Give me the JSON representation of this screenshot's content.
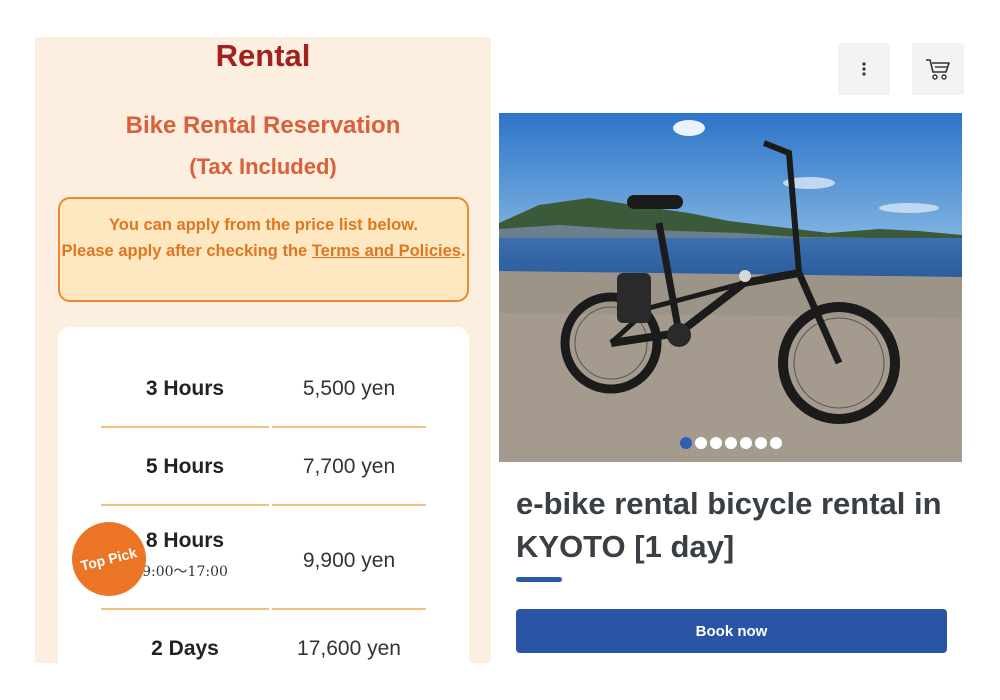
{
  "left": {
    "title": "Rental",
    "subtitle": "Bike Rental Reservation",
    "tax_note": "(Tax Included)",
    "notice": {
      "line1": "You can apply from the price list below.",
      "line2_prefix": "Please apply after checking the ",
      "link": "Terms and Policies",
      "suffix": "."
    },
    "prices": [
      {
        "name": "3 Hours",
        "price": "5,500 yen"
      },
      {
        "name": "5 Hours",
        "price": "7,700 yen"
      },
      {
        "name": "8 Hours",
        "sub": "9:00〜17:00",
        "price": "9,900 yen",
        "badge": "Top Pick"
      },
      {
        "name": "2 Days",
        "price": "17,600 yen"
      }
    ]
  },
  "right": {
    "menu_icon": "vertical-ellipsis-icon",
    "cart_icon": "cart-icon",
    "image_alt": "folding e-bike by a lake",
    "carousel": {
      "count": 7,
      "active_index": 0
    },
    "product_title": "e-bike rental bicycle rental in KYOTO [1 day]",
    "book_label": "Book now"
  },
  "colors": {
    "panel_bg": "#fcefe0",
    "title_red": "#a1211f",
    "orange": "#ec7525",
    "blue": "#2a54a6"
  }
}
